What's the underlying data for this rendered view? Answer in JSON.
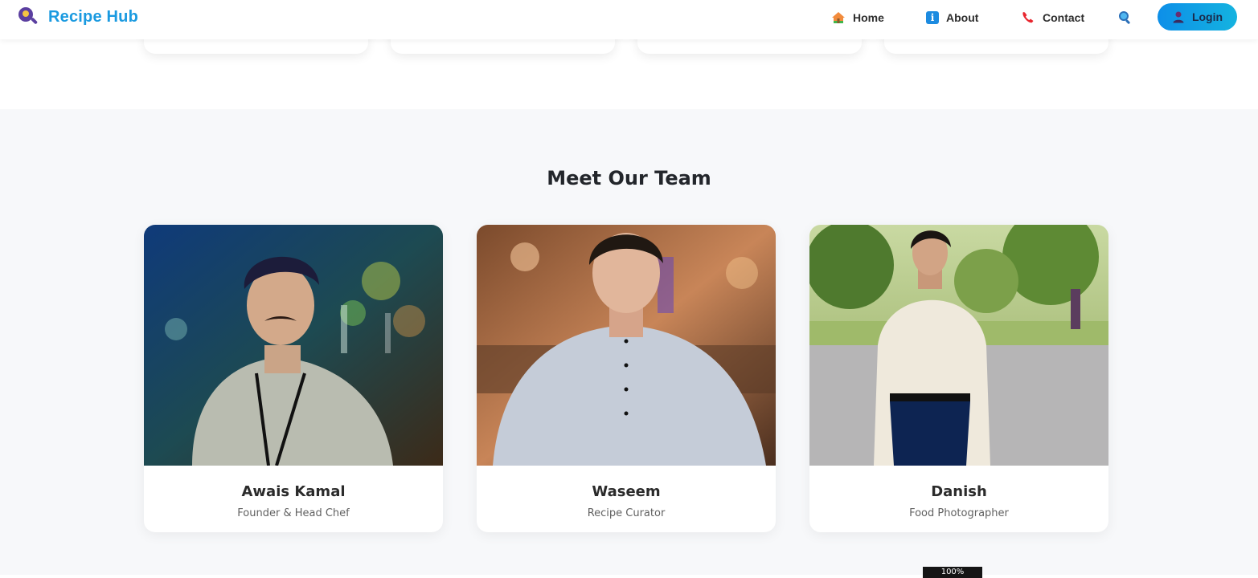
{
  "brand": {
    "name": "Recipe Hub",
    "logo_icon": "search-magnifier-logo-icon"
  },
  "nav": {
    "items": [
      {
        "label": "Home",
        "icon": "home-icon"
      },
      {
        "label": "About",
        "icon": "info-icon",
        "glyph": "i"
      },
      {
        "label": "Contact",
        "icon": "phone-icon"
      }
    ],
    "search_icon": "search-icon",
    "login_label": "Login",
    "login_icon": "user-icon"
  },
  "colors": {
    "brand": "#1a9ae0",
    "login_gradient_start": "#0d8fe8",
    "login_gradient_end": "#14b3e0",
    "section_bg": "#f7f8fa"
  },
  "team": {
    "title": "Meet Our Team",
    "members": [
      {
        "name": "Awais Kamal",
        "role": "Founder & Head Chef"
      },
      {
        "name": "Waseem",
        "role": "Recipe Curator"
      },
      {
        "name": "Danish",
        "role": "Food Photographer"
      }
    ]
  },
  "zoom_badge": "100%"
}
